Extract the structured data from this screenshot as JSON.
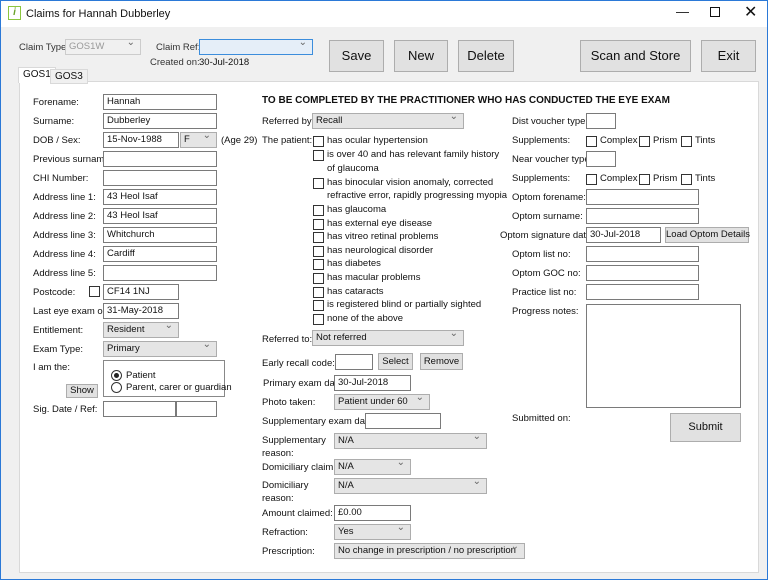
{
  "window": {
    "title": "Claims for Hannah Dubberley",
    "controls": [
      "minimize",
      "maximize",
      "close"
    ]
  },
  "header": {
    "claim_type_label": "Claim Type:",
    "claim_type_value": "GOS1W",
    "claim_ref_label": "Claim Ref:",
    "claim_ref_value": "",
    "created_on_label": "Created on:",
    "created_on_value": "30-Jul-2018",
    "buttons": {
      "save": "Save",
      "new": "New",
      "delete": "Delete",
      "scan": "Scan and Store",
      "exit": "Exit"
    }
  },
  "tabs": [
    "GOS1",
    "GOS3"
  ],
  "patient": {
    "forename_label": "Forename:",
    "forename": "Hannah",
    "surname_label": "Surname:",
    "surname": "Dubberley",
    "dob_label": "DOB / Sex:",
    "dob": "15-Nov-1988",
    "sex": "F",
    "age": "(Age 29)",
    "prev_surname_label": "Previous surname:",
    "prev_surname": "",
    "chi_label": "CHI Number:",
    "chi": "",
    "addr1_label": "Address line 1:",
    "addr1": "43 Heol Isaf",
    "addr2_label": "Address line 2:",
    "addr2": "43 Heol Isaf",
    "addr3_label": "Address line 3:",
    "addr3": "Whitchurch",
    "addr4_label": "Address line 4:",
    "addr4": "Cardiff",
    "addr5_label": "Address line 5:",
    "addr5": "",
    "postcode_label": "Postcode:",
    "postcode": "CF14 1NJ",
    "last_exam_label": "Last eye exam on:",
    "last_exam": "31-May-2018",
    "entitlement_label": "Entitlement:",
    "entitlement": "Resident",
    "exam_type_label": "Exam Type:",
    "exam_type": "Primary",
    "iam_label": "I am the:",
    "iam_options": [
      "Patient",
      "Parent, carer or guardian"
    ],
    "iam_selected": "Patient",
    "show_button": "Show",
    "sig_label": "Sig. Date / Ref:"
  },
  "practitioner": {
    "heading": "TO BE COMPLETED BY THE PRACTITIONER WHO HAS CONDUCTED THE EYE EXAM",
    "referred_by_label": "Referred by:",
    "referred_by": "Recall",
    "patient_label": "The patient:",
    "conditions": [
      "has ocular hypertension",
      "is over 40 and has relevant family history",
      "of glaucoma",
      "has binocular vision anomaly, corrected",
      "refractive error, rapidly progressing myopia",
      "has glaucoma",
      "has external eye disease",
      "has vitreo retinal problems",
      "has neurological disorder",
      "has diabetes",
      "has macular problems",
      "has cataracts",
      "is registered blind or partially sighted",
      "none of the above"
    ],
    "referred_to_label": "Referred to:",
    "referred_to": "Not referred",
    "early_recall_label": "Early recall code:",
    "select_button": "Select",
    "remove_button": "Remove",
    "primary_date_label": "Primary exam date:",
    "primary_date": "30-Jul-2018",
    "photo_label": "Photo taken:",
    "photo": "Patient under 60",
    "supp_date_label": "Supplementary exam date:",
    "supp_reason_label": [
      "Supplementary",
      "reason:"
    ],
    "supp_reason": "N/A",
    "dom_claim_label": "Domiciliary claim:",
    "dom_claim": "N/A",
    "dom_reason_label": [
      "Domiciliary",
      "reason:"
    ],
    "dom_reason": "N/A",
    "amount_label": "Amount claimed:",
    "amount": "£0.00",
    "refraction_label": "Refraction:",
    "refraction": "Yes",
    "prescription_label": "Prescription:",
    "prescription": "No change in prescription / no prescription"
  },
  "right": {
    "dist_label": "Dist voucher type:",
    "supp_label": "Supplements:",
    "supp_options": [
      "Complex",
      "Prism",
      "Tints"
    ],
    "near_label": "Near voucher type:",
    "optom_forename_label": "Optom forename:",
    "optom_surname_label": "Optom surname:",
    "optom_sig_label": "Optom signature date:",
    "optom_sig": "30-Jul-2018",
    "load_button": "Load Optom Details",
    "optom_list_label": "Optom list no:",
    "optom_goc_label": "Optom GOC no:",
    "practice_list_label": "Practice list no:",
    "progress_label": "Progress notes:",
    "submitted_label": "Submitted on:",
    "submit_button": "Submit"
  }
}
